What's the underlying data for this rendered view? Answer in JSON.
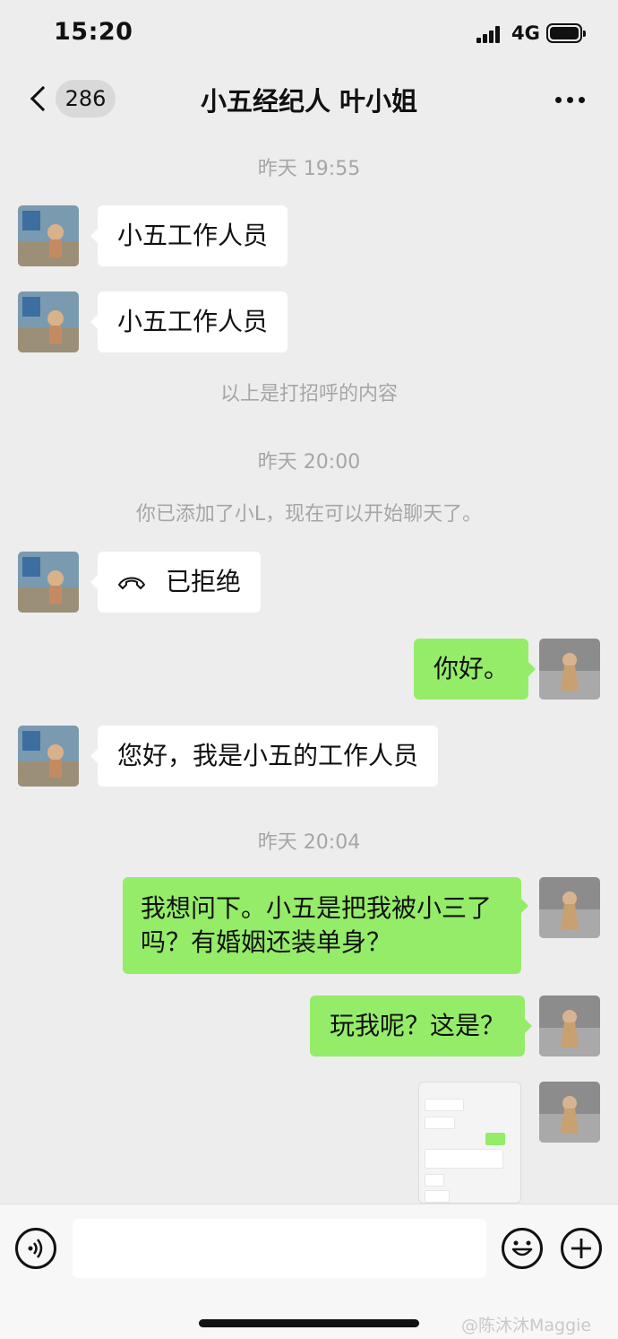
{
  "status_bar": {
    "time": "15:20",
    "network": "4G"
  },
  "nav": {
    "unread_count": "286",
    "title": "小五经纪人 叶小姐"
  },
  "messages": {
    "timestamp_1": "昨天 19:55",
    "in_1": "小五工作人员",
    "in_2": "小五工作人员",
    "system_greeting": "以上是打招呼的内容",
    "timestamp_2": "昨天 20:00",
    "system_added": "你已添加了小L，现在可以开始聊天了。",
    "call_status": "已拒绝",
    "out_1": "你好。",
    "in_3": "您好，我是小五的工作人员",
    "timestamp_3": "昨天 20:04",
    "out_2": "我想问下。小五是把我被小三了吗？有婚姻还装单身？",
    "out_3": "玩我呢？这是？"
  },
  "watermark": "@陈沐沐Maggie",
  "icons": [
    "back-icon",
    "more-icon",
    "hangup-icon",
    "voice-icon",
    "emoji-icon",
    "add-icon",
    "signal-icon",
    "battery-icon"
  ],
  "colors": {
    "background": "#ededed",
    "outgoing_bubble": "#95ec69",
    "incoming_bubble": "#ffffff"
  }
}
